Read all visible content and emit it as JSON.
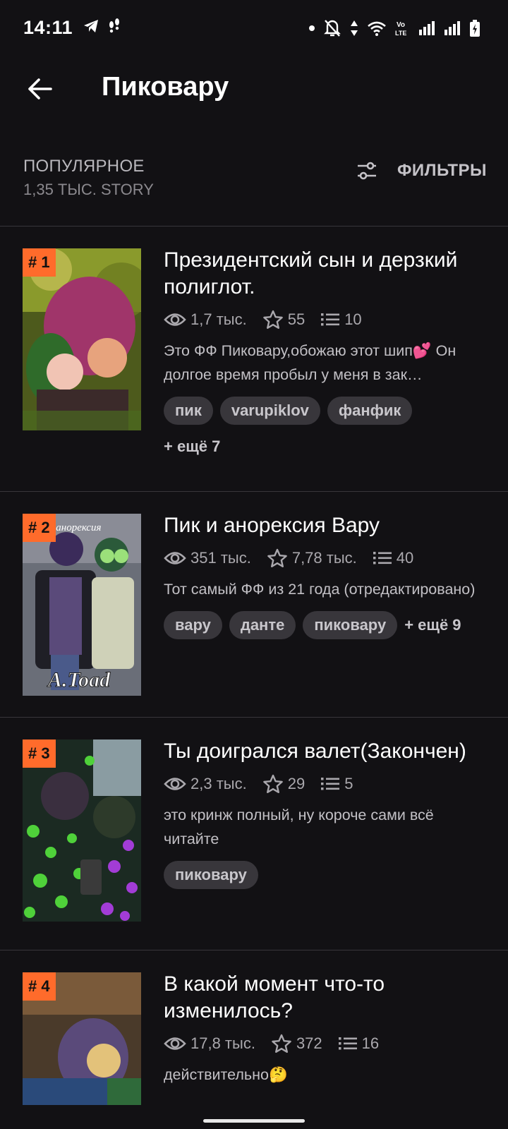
{
  "status_bar": {
    "time": "14:11"
  },
  "app_bar": {
    "title": "Пиковару"
  },
  "list_header": {
    "sort_label": "ПОПУЛЯРНОЕ",
    "count_label": "1,35 ТЫС. STORY",
    "filter_label": "ФИЛЬТРЫ"
  },
  "stories": [
    {
      "rank": "# 1",
      "title": "Президентский сын и дерзкий полиглот.",
      "views": "1,7 тыс.",
      "votes": "55",
      "parts": "10",
      "description": "Это ФФ Пиковару,обожаю этот шип💕 Он долгое время пробыл у меня в зак…",
      "tags": [
        "пик",
        "varupiklov",
        "фанфик"
      ],
      "more_tags": "+ ещё 7"
    },
    {
      "rank": "# 2",
      "title": "Пик и анорексия Вару",
      "views": "351 тыс.",
      "votes": "7,78 тыс.",
      "parts": "40",
      "description": "Тот самый ФФ из 21 года (отредактировано)",
      "tags": [
        "вару",
        "данте",
        "пиковару"
      ],
      "more_tags": "+ ещё 9",
      "cover_text": "A.Toad",
      "cover_top_text": "и анорексия"
    },
    {
      "rank": "# 3",
      "title": "Ты доигрался валет(Закончен)",
      "views": "2,3 тыс.",
      "votes": "29",
      "parts": "5",
      "description": "это кринж полный, ну короче сами всё читайте",
      "tags": [
        "пиковару"
      ]
    },
    {
      "rank": "# 4",
      "title": "В какой момент что-то изменилось?",
      "views": "17,8 тыс.",
      "votes": "372",
      "parts": "16",
      "description": "действительно🤔"
    }
  ],
  "colors": {
    "background": "#121114",
    "rank_badge": "#ff6b2b",
    "tag_bg": "#38363b"
  }
}
